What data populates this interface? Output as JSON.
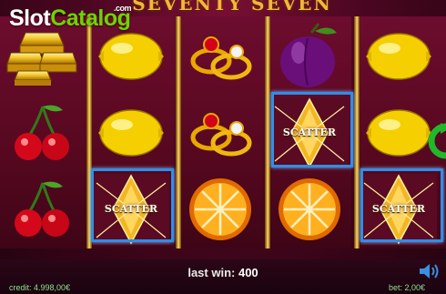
{
  "game": {
    "title": "SEVENTY SEVEN"
  },
  "watermark": {
    "slot": "Slot",
    "catalog": "Catalog",
    "com": ".com"
  },
  "reels": [
    [
      "gold-bars",
      "cherries",
      "cherries"
    ],
    [
      "lemon",
      "lemon",
      "scatter"
    ],
    [
      "rings",
      "rings",
      "orange"
    ],
    [
      "plum",
      "scatter",
      "orange"
    ],
    [
      "lemon",
      "lemon",
      "scatter"
    ]
  ],
  "scatter_label": "SCATTER",
  "status": {
    "last_win_label": "last win:",
    "last_win_value": "400",
    "credit_label": "credit:",
    "credit_value": "4.998,00€",
    "bet_label": "bet:",
    "bet_value": "2,00€"
  },
  "colors": {
    "highlight": "#2f8ee8",
    "reel_frame": "#f0c24a",
    "text_green": "#8fe08f"
  },
  "icons": [
    "sound-icon",
    "spin-arrow-icon"
  ]
}
